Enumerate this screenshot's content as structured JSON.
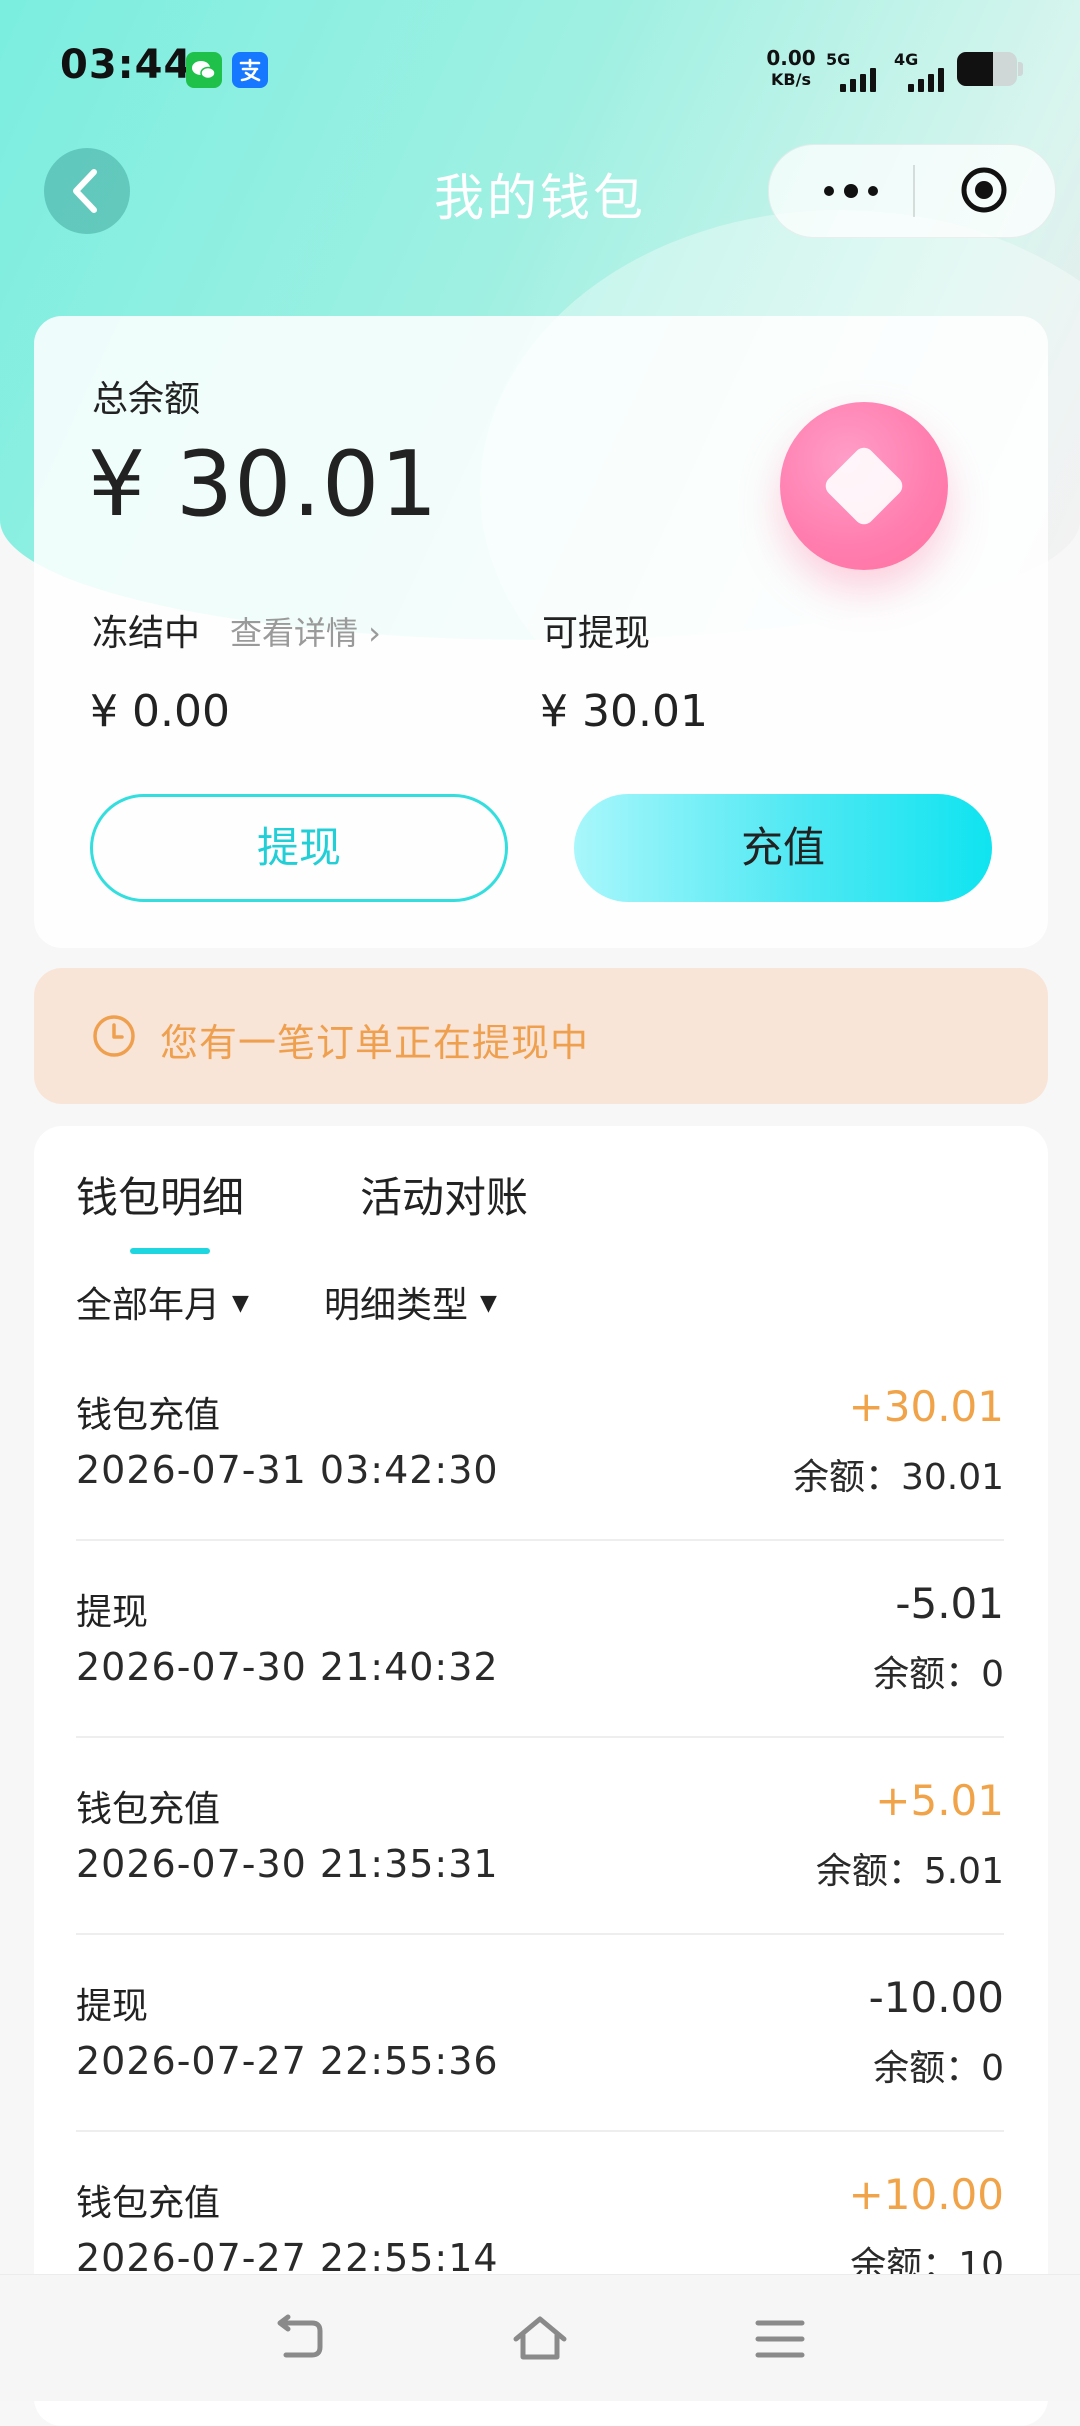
{
  "status": {
    "time": "03:44",
    "net_speed_value": "0.00",
    "net_speed_unit": "KB/s",
    "signal_5g": "5G",
    "signal_4g": "4G",
    "battery_level": 0.6
  },
  "header": {
    "title": "我的钱包"
  },
  "balance": {
    "total_label": "总余额",
    "total_value": "¥ 30.01",
    "frozen_label": "冻结中",
    "frozen_link": "查看详情 ›",
    "frozen_value": "¥ 0.00",
    "withdrawable_label": "可提现",
    "withdrawable_value": "¥ 30.01",
    "withdraw_button": "提现",
    "recharge_button": "充值"
  },
  "notice": {
    "text": "您有一笔订单正在提现中"
  },
  "records": {
    "tabs": [
      {
        "label": "钱包明细",
        "active": true
      },
      {
        "label": "活动对账",
        "active": false
      }
    ],
    "filters": [
      {
        "label": "全部年月"
      },
      {
        "label": "明细类型"
      }
    ],
    "items": [
      {
        "type": "钱包充值",
        "time": "2026-07-31 03:42:30",
        "amount": "+30.01",
        "balance": "余额：30.01"
      },
      {
        "type": "提现",
        "time": "2026-07-30 21:40:32",
        "amount": "-5.01",
        "balance": "余额：0"
      },
      {
        "type": "钱包充值",
        "time": "2026-07-30 21:35:31",
        "amount": "+5.01",
        "balance": "余额：5.01"
      },
      {
        "type": "提现",
        "time": "2026-07-27 22:55:36",
        "amount": "-10.00",
        "balance": "余额：0"
      },
      {
        "type": "钱包充值",
        "time": "2026-07-27 22:55:14",
        "amount": "+10.00",
        "balance": "余额：10"
      }
    ]
  },
  "colors": {
    "accent": "#1ed6e0",
    "income": "#f0a348",
    "notice_bg": "#f9e5d8",
    "notice_text": "#efa04f"
  }
}
